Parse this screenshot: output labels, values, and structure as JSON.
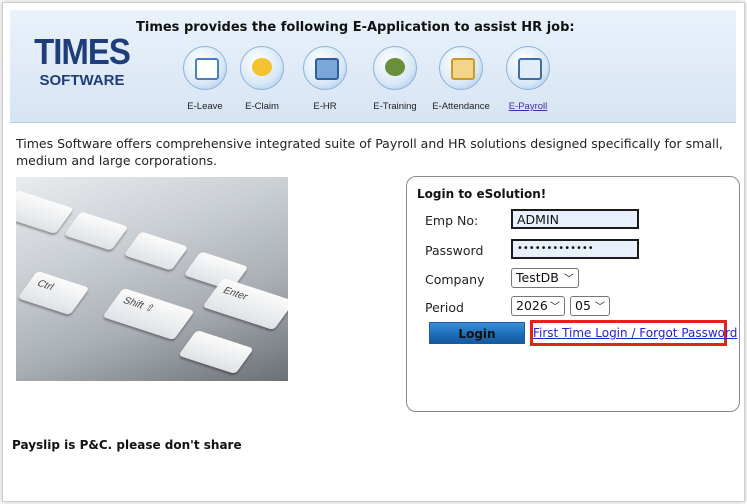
{
  "header": {
    "logo_top": "TIMES",
    "logo_bottom": "SOFTWARE",
    "title": "Times provides the following E-Application to assist HR job:",
    "apps": [
      {
        "label": "E-Leave",
        "icon": "leave-icon",
        "active": false
      },
      {
        "label": "E-Claim",
        "icon": "claim-icon",
        "active": false
      },
      {
        "label": "E-HR",
        "icon": "hr-icon",
        "active": false
      },
      {
        "label": "E-Training",
        "icon": "training-icon",
        "active": false
      },
      {
        "label": "E-Attendance",
        "icon": "attendance-icon",
        "active": false
      },
      {
        "label": "E-Payroll",
        "icon": "payroll-icon",
        "active": true
      }
    ]
  },
  "intro": "Times Software offers comprehensive integrated suite of Payroll and HR solutions designed specifically for small, medium and large corporations.",
  "keyboard_keys": [
    "Ctrl",
    "Shift ⇧",
    "Enter"
  ],
  "login": {
    "title": "Login to eSolution!",
    "emp_no_label": "Emp No:",
    "emp_no_value": "ADMIN",
    "password_label": "Password",
    "password_value": "•••••••••••••",
    "company_label": "Company",
    "company_value": "TestDB",
    "period_label": "Period",
    "period_year": "2026",
    "period_month": "05",
    "login_button": "Login",
    "forgot_link": "First Time Login / Forgot Password"
  },
  "footer_note": "Payslip is P&C. please don't share",
  "colors": {
    "header_bg": "#d6e4f3",
    "logo": "#1f3d78",
    "link": "#2323d6",
    "highlight": "#e2231a",
    "button": "#1c6ab5"
  }
}
